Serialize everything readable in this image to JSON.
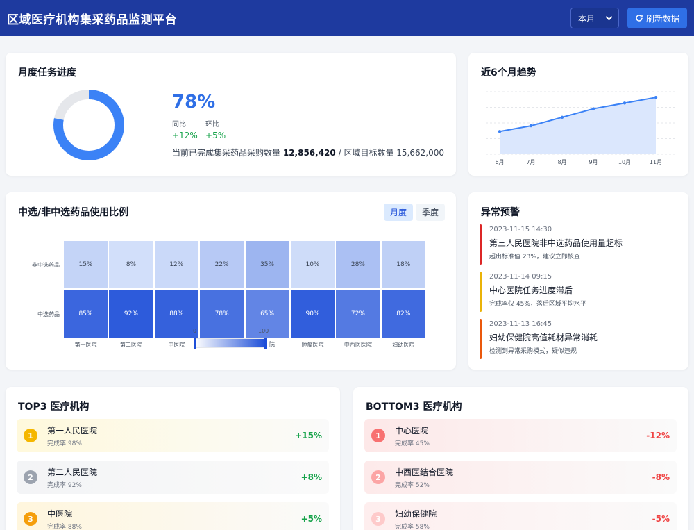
{
  "header": {
    "title": "区域医疗机构集采药品监测平台",
    "period": "本月",
    "refresh_label": "刷新数据"
  },
  "progress": {
    "title": "月度任务进度",
    "percent_label": "78%",
    "percent": 0.78,
    "yoy_label": "同比",
    "yoy_value": "+12%",
    "mom_label": "环比",
    "mom_value": "+5%",
    "summary_prefix": "当前已完成集采药品采购数量",
    "completed": "12,856,420",
    "summary_mid": "/ 区域目标数量",
    "target": "15,662,000",
    "colors": {
      "fill": "#3b82f6",
      "track": "#e5e7eb"
    }
  },
  "trend": {
    "title": "近6个月趋势",
    "chart_data": {
      "type": "area",
      "x": [
        "6月",
        "7月",
        "8月",
        "9月",
        "10月",
        "11月"
      ],
      "values": [
        68,
        70,
        73,
        76,
        78,
        80
      ],
      "ylim": [
        60,
        82
      ],
      "grid": true,
      "color": "#3b82f6"
    }
  },
  "ratio": {
    "title": "中选/非中选药品使用比例",
    "tabs": [
      "月度",
      "季度"
    ],
    "active_tab": 0,
    "chart_data": {
      "type": "heatmap",
      "categories": [
        "第一医院",
        "第二医院",
        "中医院",
        "",
        "",
        "肿瘤医院",
        "中西医医院",
        "妇幼医院"
      ],
      "rows": [
        "非中选药品",
        "中选药品"
      ],
      "values": [
        [
          15,
          8,
          12,
          22,
          35,
          10,
          28,
          18
        ],
        [
          85,
          92,
          88,
          78,
          65,
          90,
          72,
          82
        ]
      ],
      "labels": [
        [
          "15%",
          "8%",
          "12%",
          "22%",
          "35%",
          "10%",
          "28%",
          "18%"
        ],
        [
          "85%",
          "92%",
          "88%",
          "78%",
          "65%",
          "90%",
          "72%",
          "82%"
        ]
      ],
      "visualmap": {
        "min_label": "0",
        "max_label": "100",
        "min": 0,
        "max": 100
      }
    },
    "partial_label": "院"
  },
  "alerts": {
    "title": "异常预警",
    "items": [
      {
        "time": "2023-11-15 14:30",
        "title": "第三人民医院非中选药品使用量超标",
        "desc": "超出标准值 23%，建议立即核查",
        "color": "#dc2626"
      },
      {
        "time": "2023-11-14 09:15",
        "title": "中心医院任务进度滞后",
        "desc": "完成率仅 45%，落后区域平均水平",
        "color": "#eab308"
      },
      {
        "time": "2023-11-13 16:45",
        "title": "妇幼保健院高值耗材异常消耗",
        "desc": "检测到异常采购模式，疑似违规",
        "color": "#ea580c"
      }
    ]
  },
  "top3": {
    "title": "TOP3 医疗机构",
    "items": [
      {
        "rank": "1",
        "name": "第一人民医院",
        "rate": "完成率 98%",
        "delta": "+15%",
        "medal": "#f5b700",
        "bg": "#fff9dc"
      },
      {
        "rank": "2",
        "name": "第二人民医院",
        "rate": "完成率 92%",
        "delta": "+8%",
        "medal": "#9ca3af",
        "bg": "#f3f4f6"
      },
      {
        "rank": "3",
        "name": "中医院",
        "rate": "完成率 88%",
        "delta": "+5%",
        "medal": "#f59e0b",
        "bg": "#fff6dd"
      }
    ],
    "delta_color": "#16a34a"
  },
  "bottom3": {
    "title": "BOTTOM3 医疗机构",
    "items": [
      {
        "rank": "1",
        "name": "中心医院",
        "rate": "完成率 45%",
        "delta": "-12%",
        "medal": "#f87171",
        "bg": "#fde8e8"
      },
      {
        "rank": "2",
        "name": "中西医结合医院",
        "rate": "完成率 52%",
        "delta": "-8%",
        "medal": "#fca5a5",
        "bg": "#fdeaea"
      },
      {
        "rank": "3",
        "name": "妇幼保健院",
        "rate": "完成率 58%",
        "delta": "-5%",
        "medal": "#fecaca",
        "bg": "#feeeee"
      }
    ],
    "delta_color": "#ef4444"
  }
}
